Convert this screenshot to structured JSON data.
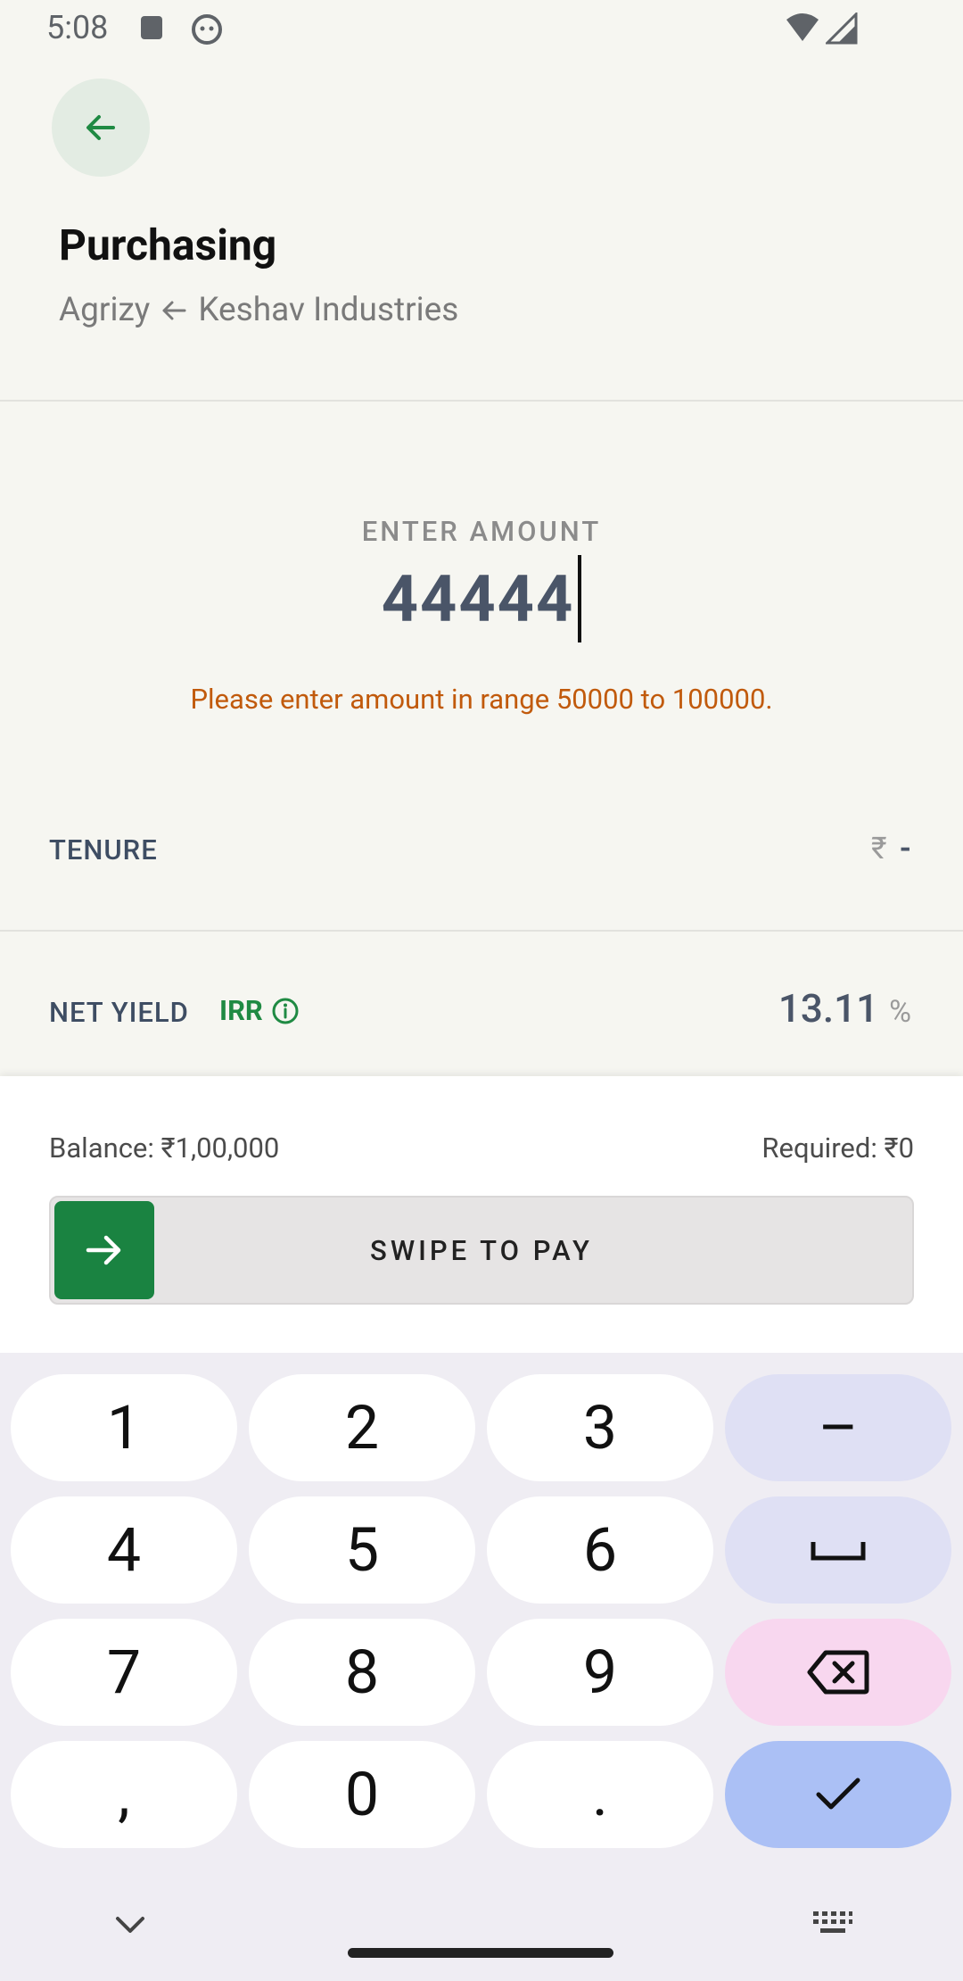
{
  "status_bar": {
    "time": "5:08"
  },
  "header": {
    "title": "Purchasing",
    "subtitle_from": "Agrizy",
    "subtitle_to": "Keshav Industries"
  },
  "amount": {
    "label": "ENTER AMOUNT",
    "value": "44444",
    "error": "Please enter amount in range 50000 to 100000."
  },
  "tenure": {
    "label": "TENURE",
    "currency": "₹",
    "value": "-"
  },
  "net_yield": {
    "label": "NET YIELD",
    "irr_label": "IRR",
    "value": "13.11",
    "unit": "%"
  },
  "payment": {
    "balance": "Balance: ₹1,00,000",
    "required": "Required: ₹0",
    "swipe_label": "SWIPE TO PAY"
  },
  "keyboard": {
    "keys": [
      "1",
      "2",
      "3",
      "–",
      "4",
      "5",
      "6",
      "␣",
      "7",
      "8",
      "9",
      "⌫",
      ",",
      "0",
      ".",
      "✓"
    ]
  },
  "colors": {
    "accent_green": "#1a8341",
    "error_orange": "#c15a0c",
    "background": "#f6f6f1"
  }
}
